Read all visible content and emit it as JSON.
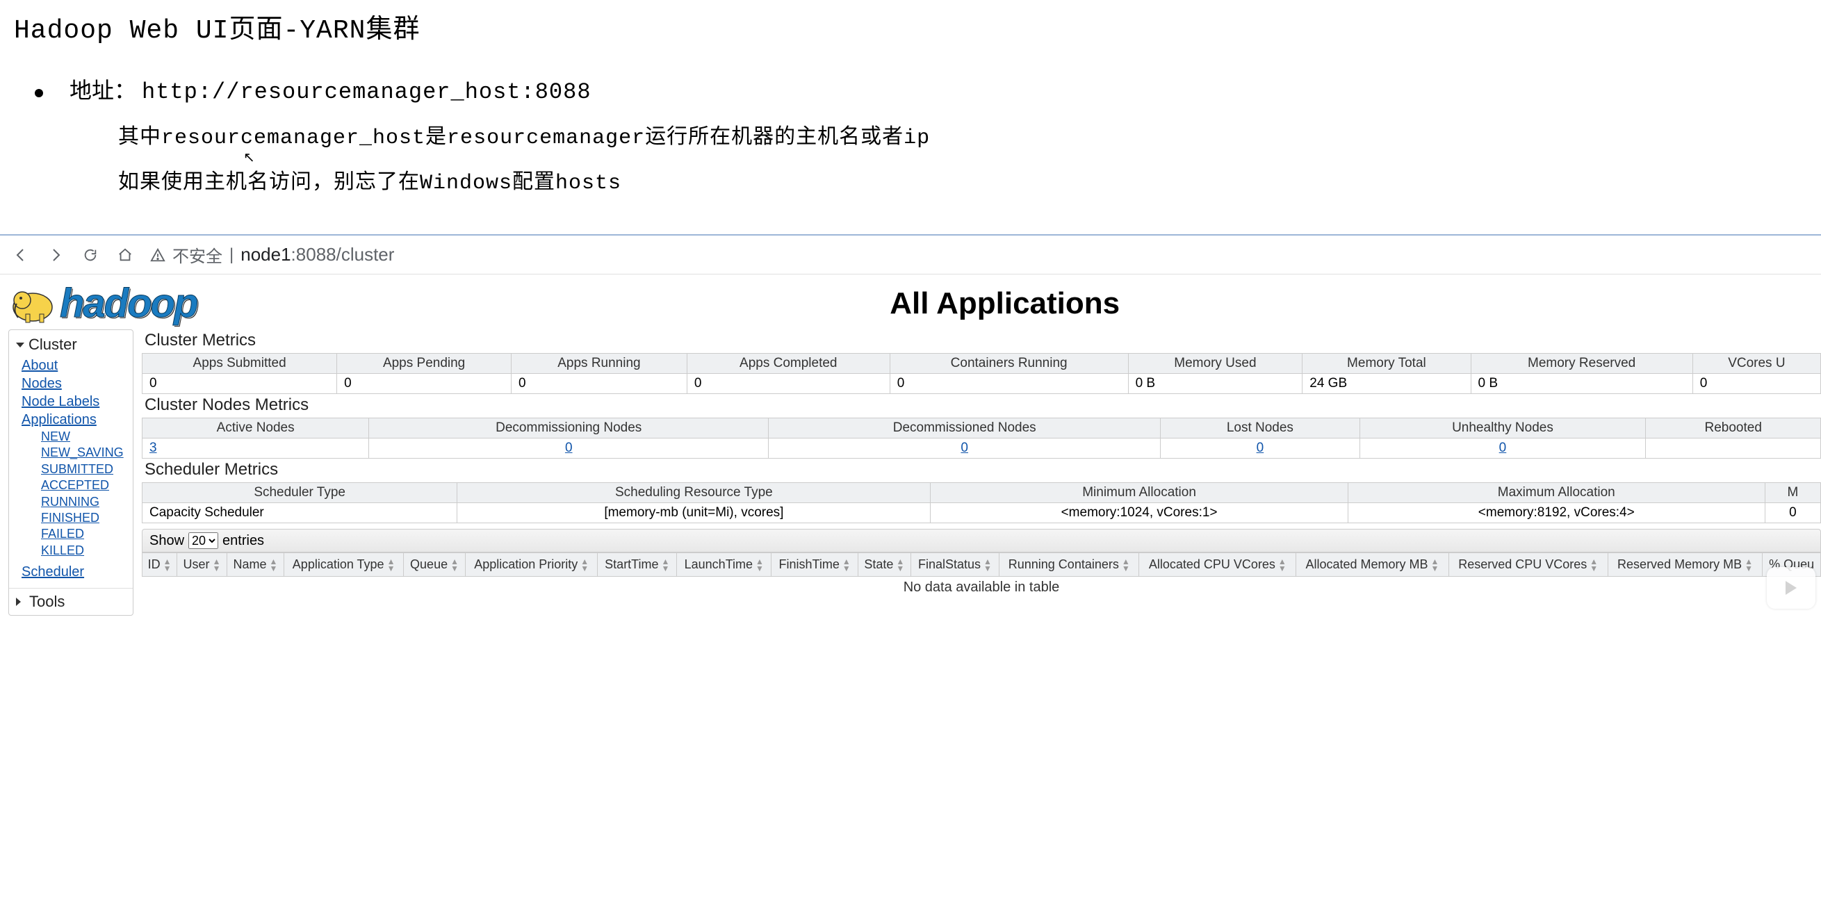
{
  "slide": {
    "title": "Hadoop Web UI页面-YARN集群",
    "bullet_prefix": "地址：",
    "url": "http://resourcemanager_host:8088",
    "line2": "其中resourcemanager_host是resourcemanager运行所在机器的主机名或者ip",
    "line3": "如果使用主机名访问，别忘了在Windows配置hosts"
  },
  "browser": {
    "insecure_label": "不安全",
    "separator": "|",
    "host": "node1",
    "port_path": ":8088/cluster"
  },
  "yarn": {
    "logo_text": "hadoop",
    "page_title": "All Applications",
    "sidebar": {
      "cluster_label": "Cluster",
      "links": [
        "About",
        "Nodes",
        "Node Labels",
        "Applications"
      ],
      "app_states": [
        "NEW",
        "NEW_SAVING",
        "SUBMITTED",
        "ACCEPTED",
        "RUNNING",
        "FINISHED",
        "FAILED",
        "KILLED"
      ],
      "scheduler_label": "Scheduler",
      "tools_label": "Tools"
    },
    "cluster_metrics": {
      "title": "Cluster Metrics",
      "headers": [
        "Apps Submitted",
        "Apps Pending",
        "Apps Running",
        "Apps Completed",
        "Containers Running",
        "Memory Used",
        "Memory Total",
        "Memory Reserved",
        "VCores U"
      ],
      "values": [
        "0",
        "0",
        "0",
        "0",
        "0",
        "0 B",
        "24 GB",
        "0 B",
        "0"
      ]
    },
    "nodes_metrics": {
      "title": "Cluster Nodes Metrics",
      "headers": [
        "Active Nodes",
        "Decommissioning Nodes",
        "Decommissioned Nodes",
        "Lost Nodes",
        "Unhealthy Nodes",
        "Rebooted"
      ],
      "values": [
        "3",
        "0",
        "0",
        "0",
        "0",
        ""
      ]
    },
    "scheduler_metrics": {
      "title": "Scheduler Metrics",
      "headers": [
        "Scheduler Type",
        "Scheduling Resource Type",
        "Minimum Allocation",
        "Maximum Allocation",
        "M"
      ],
      "values": [
        "Capacity Scheduler",
        "[memory-mb (unit=Mi), vcores]",
        "<memory:1024, vCores:1>",
        "<memory:8192, vCores:4>",
        "0"
      ]
    },
    "apps_table": {
      "show_label_pre": "Show",
      "show_label_post": "entries",
      "page_size": "20",
      "columns": [
        "ID",
        "User",
        "Name",
        "Application Type",
        "Queue",
        "Application Priority",
        "StartTime",
        "LaunchTime",
        "FinishTime",
        "State",
        "FinalStatus",
        "Running Containers",
        "Allocated CPU VCores",
        "Allocated Memory MB",
        "Reserved CPU VCores",
        "Reserved Memory MB",
        "% Queu"
      ],
      "empty": "No data available in table"
    }
  }
}
